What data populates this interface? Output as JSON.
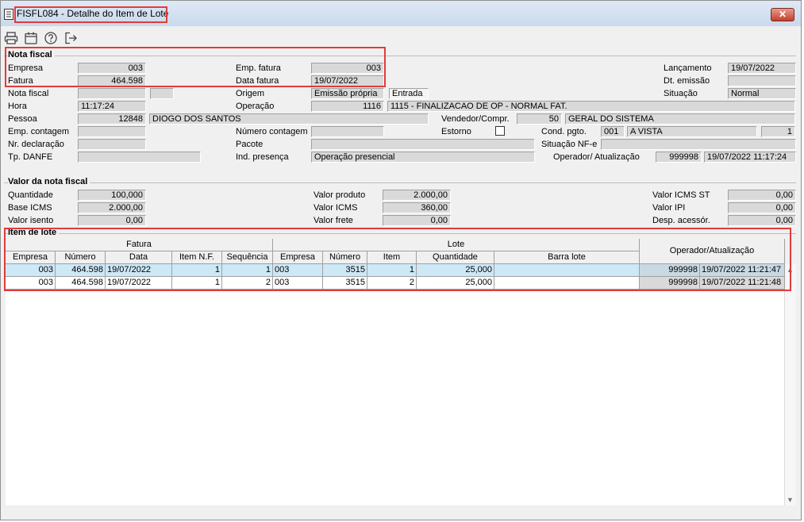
{
  "window": {
    "title": "FISFL084 - Detalhe do Item de Lote",
    "close_label": "✕"
  },
  "toolbar": {
    "icons": [
      "printer-icon",
      "calendar-icon",
      "help-icon",
      "exit-icon"
    ]
  },
  "nota_fiscal": {
    "group_title": "Nota fiscal",
    "empresa_label": "Empresa",
    "empresa": "003",
    "fatura_label": "Fatura",
    "fatura": "464.598",
    "nota_fiscal_label": "Nota fiscal",
    "nota_fiscal": "",
    "nota_fiscal_serie": "",
    "hora_label": "Hora",
    "hora": "11:17:24",
    "pessoa_label": "Pessoa",
    "pessoa_codigo": "12848",
    "pessoa_nome": "DIOGO DOS SANTOS",
    "emp_contagem_label": "Emp. contagem",
    "emp_contagem": "",
    "nr_declaracao_label": "Nr. declaração",
    "nr_declaracao": "",
    "tp_danfe_label": "Tp. DANFE",
    "tp_danfe": "",
    "emp_fatura_label": "Emp. fatura",
    "emp_fatura": "003",
    "data_fatura_label": "Data fatura",
    "data_fatura": "19/07/2022",
    "origem_label": "Origem",
    "origem": "Emissão própria",
    "origem_tipo": "Entrada",
    "operacao_label": "Operação",
    "operacao_codigo": "1116",
    "operacao_desc": "1115 - FINALIZACAO DE OP - NORMAL FAT.",
    "vendedor_label": "Vendedor/Compr.",
    "vendedor_codigo": "50",
    "vendedor_nome": "GERAL DO SISTEMA",
    "numero_contagem_label": "Número contagem",
    "numero_contagem": "",
    "estorno_label": "Estorno",
    "pacote_label": "Pacote",
    "pacote": "",
    "ind_presenca_label": "Ind. presença",
    "ind_presenca": "Operação presencial",
    "lancamento_label": "Lançamento",
    "lancamento": "19/07/2022",
    "dt_emissao_label": "Dt. emissão",
    "dt_emissao": "",
    "situacao_label": "Situação",
    "situacao": "Normal",
    "cond_pgto_label": "Cond. pgto.",
    "cond_pgto_codigo": "001",
    "cond_pgto_desc": "A VISTA",
    "cond_pgto_parcelas": "1",
    "situacao_nfe_label": "Situação NF-e",
    "situacao_nfe": "",
    "operador_label": "Operador/ Atualização",
    "operador_codigo": "999998",
    "operador_data": "19/07/2022 11:17:24"
  },
  "valor_nf": {
    "group_title": "Valor da nota fiscal",
    "quantidade_label": "Quantidade",
    "quantidade": "100,000",
    "base_icms_label": "Base ICMS",
    "base_icms": "2.000,00",
    "valor_isento_label": "Valor isento",
    "valor_isento": "0,00",
    "valor_produto_label": "Valor produto",
    "valor_produto": "2.000,00",
    "valor_icms_label": "Valor ICMS",
    "valor_icms": "360,00",
    "valor_frete_label": "Valor frete",
    "valor_frete": "0,00",
    "valor_icms_st_label": "Valor ICMS ST",
    "valor_icms_st": "0,00",
    "valor_ipi_label": "Valor IPI",
    "valor_ipi": "0,00",
    "desp_acessor_label": "Desp. acessór.",
    "desp_acessor": "0,00"
  },
  "item_lote": {
    "group_title": "Item de lote",
    "group_headers": {
      "fatura": "Fatura",
      "lote": "Lote",
      "operador": "Operador/Atualização"
    },
    "columns": [
      "Empresa",
      "Número",
      "Data",
      "Item N.F.",
      "Sequência",
      "Empresa",
      "Número",
      "Item",
      "Quantidade",
      "Barra lote"
    ],
    "rows": [
      {
        "empresa": "003",
        "numero": "464.598",
        "data": "19/07/2022",
        "item_nf": "1",
        "sequencia": "1",
        "lote_empresa": "003",
        "lote_numero": "3515",
        "lote_item": "1",
        "quantidade": "25,000",
        "barra_lote": "",
        "operador": "999998",
        "atualizacao": "19/07/2022 11:21:47"
      },
      {
        "empresa": "003",
        "numero": "464.598",
        "data": "19/07/2022",
        "item_nf": "1",
        "sequencia": "2",
        "lote_empresa": "003",
        "lote_numero": "3515",
        "lote_item": "2",
        "quantidade": "25,000",
        "barra_lote": "",
        "operador": "999998",
        "atualizacao": "19/07/2022 11:21:48"
      }
    ]
  }
}
